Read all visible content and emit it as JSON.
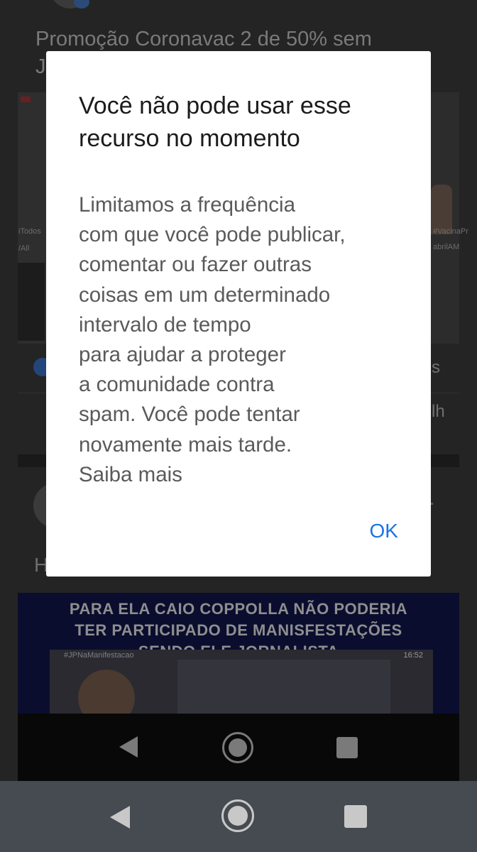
{
  "background_feed": {
    "post_title_line1": "Promoção Coronavac 2 de 50% sem",
    "post_title_line2": "J",
    "reaction_tail": "s",
    "action_tail": "lh",
    "comment_initial": "H",
    "video_side_text_left_1": "iTodos",
    "video_side_text_left_2": "/All",
    "video_side_text_right_1": "#VacinaPr",
    "video_side_text_right_2": "abrilAM",
    "thumbnail": {
      "caption_lines": [
        "PARA ELA CAIO COPPOLLA NÃO PODERIA",
        "TER PARTICIPADO DE MANISFESTAÇÕES",
        "SENDO ELE JORNALISTA"
      ],
      "hashtag": "#JPNaManifestacao",
      "timecode": "16:52"
    }
  },
  "dialog": {
    "title": "Você não pode usar esse recurso no momento",
    "body_lines": [
      "Limitamos a frequência",
      "com que você pode publicar,",
      "comentar ou fazer outras",
      "coisas em um determinado",
      "intervalo de tempo",
      "para ajudar a proteger",
      "a comunidade contra",
      "spam. Você pode tentar",
      "novamente mais tarde.",
      "Saiba mais"
    ],
    "ok_label": "OK"
  },
  "navigation": {
    "back_icon": "back-triangle-icon",
    "home_icon": "home-circle-icon",
    "recents_icon": "recents-square-icon"
  }
}
